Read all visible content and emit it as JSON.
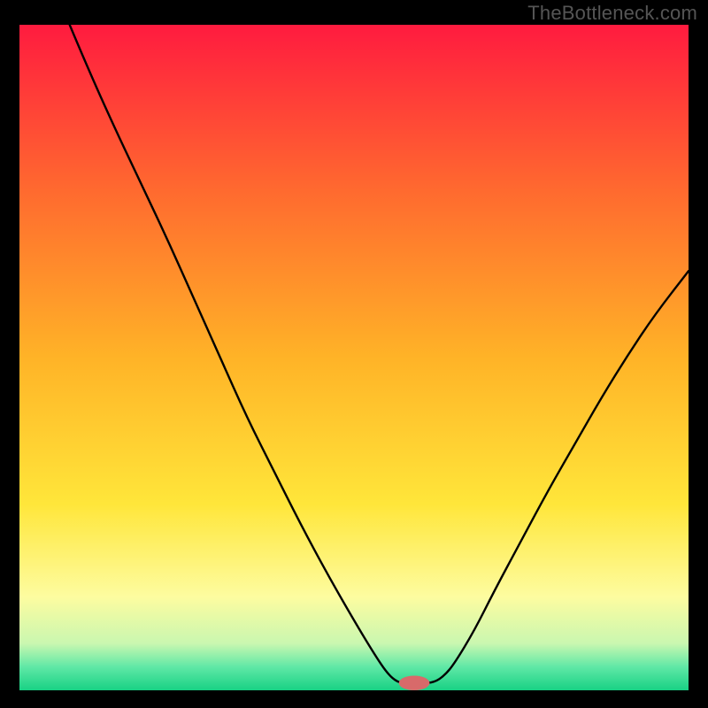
{
  "watermark": "TheBottleneck.com",
  "chart_data": {
    "type": "line",
    "title": "",
    "xlabel": "",
    "ylabel": "",
    "xlim": [
      0,
      100
    ],
    "ylim": [
      0,
      100
    ],
    "grid": false,
    "legend": false,
    "gradient_stops": [
      {
        "offset": 0,
        "color": "#ff1b3f"
      },
      {
        "offset": 25,
        "color": "#ff6a2f"
      },
      {
        "offset": 50,
        "color": "#ffb327"
      },
      {
        "offset": 72,
        "color": "#ffe63a"
      },
      {
        "offset": 86,
        "color": "#fdfca0"
      },
      {
        "offset": 93,
        "color": "#c9f7b0"
      },
      {
        "offset": 96.5,
        "color": "#5fe8a6"
      },
      {
        "offset": 100,
        "color": "#18d184"
      }
    ],
    "series": [
      {
        "name": "curve",
        "points": [
          {
            "x": 7.5,
            "y": 100
          },
          {
            "x": 10,
            "y": 94
          },
          {
            "x": 14,
            "y": 85
          },
          {
            "x": 18,
            "y": 76.5
          },
          {
            "x": 22,
            "y": 68
          },
          {
            "x": 26,
            "y": 59
          },
          {
            "x": 30,
            "y": 50
          },
          {
            "x": 34,
            "y": 41
          },
          {
            "x": 38,
            "y": 33
          },
          {
            "x": 42,
            "y": 25
          },
          {
            "x": 46,
            "y": 17.5
          },
          {
            "x": 50,
            "y": 10.5
          },
          {
            "x": 53,
            "y": 5.5
          },
          {
            "x": 55,
            "y": 2.5
          },
          {
            "x": 56.5,
            "y": 1.2
          },
          {
            "x": 58,
            "y": 1.0
          },
          {
            "x": 60,
            "y": 1.0
          },
          {
            "x": 62,
            "y": 1.2
          },
          {
            "x": 63.5,
            "y": 2.2
          },
          {
            "x": 65,
            "y": 4
          },
          {
            "x": 68,
            "y": 9
          },
          {
            "x": 71,
            "y": 15
          },
          {
            "x": 75,
            "y": 22.5
          },
          {
            "x": 79,
            "y": 30
          },
          {
            "x": 83,
            "y": 37
          },
          {
            "x": 87,
            "y": 44
          },
          {
            "x": 91,
            "y": 50.5
          },
          {
            "x": 95,
            "y": 56.5
          },
          {
            "x": 100,
            "y": 63
          }
        ]
      }
    ],
    "marker": {
      "x": 59,
      "y": 1.1,
      "rx": 2.3,
      "ry": 1.1,
      "color": "#d86a6a"
    }
  }
}
